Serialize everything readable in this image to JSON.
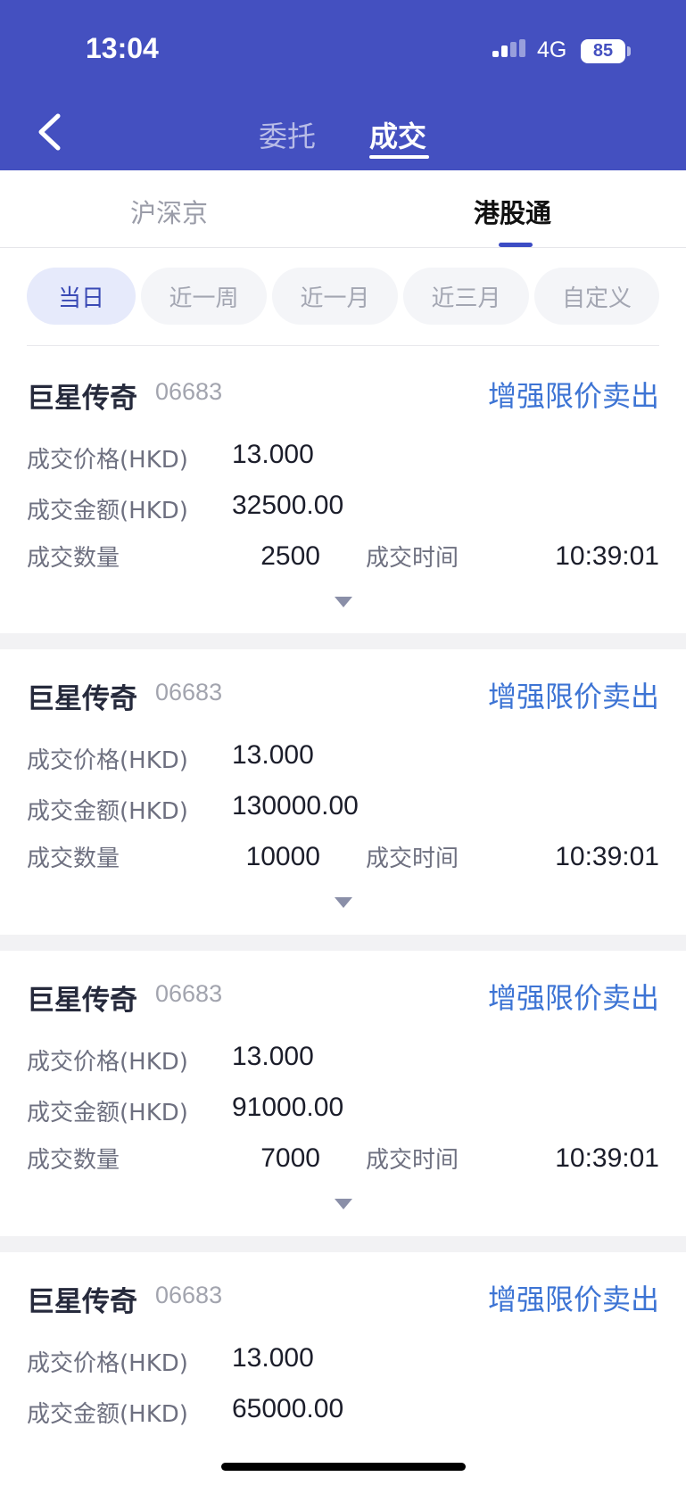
{
  "status_bar": {
    "time": "13:04",
    "network": "4G",
    "battery": "85"
  },
  "header": {
    "tabs": [
      {
        "label": "委托",
        "active": false
      },
      {
        "label": "成交",
        "active": true
      }
    ]
  },
  "markets": [
    {
      "label": "沪深京",
      "active": false
    },
    {
      "label": "港股通",
      "active": true
    }
  ],
  "filters": [
    {
      "label": "当日",
      "active": true
    },
    {
      "label": "近一周",
      "active": false
    },
    {
      "label": "近一月",
      "active": false
    },
    {
      "label": "近三月",
      "active": false
    },
    {
      "label": "自定义",
      "active": false
    }
  ],
  "labels": {
    "price": "成交价格(HKD)",
    "amount": "成交金额(HKD)",
    "quantity": "成交数量",
    "time": "成交时间"
  },
  "trades": [
    {
      "name": "巨星传奇",
      "code": "06683",
      "order_type": "增强限价卖出",
      "price": "13.000",
      "amount": "32500.00",
      "quantity": "2500",
      "time": "10:39:01"
    },
    {
      "name": "巨星传奇",
      "code": "06683",
      "order_type": "增强限价卖出",
      "price": "13.000",
      "amount": "130000.00",
      "quantity": "10000",
      "time": "10:39:01"
    },
    {
      "name": "巨星传奇",
      "code": "06683",
      "order_type": "增强限价卖出",
      "price": "13.000",
      "amount": "91000.00",
      "quantity": "7000",
      "time": "10:39:01"
    },
    {
      "name": "巨星传奇",
      "code": "06683",
      "order_type": "增强限价卖出",
      "price": "13.000",
      "amount": "65000.00"
    }
  ],
  "colors": {
    "header_bg": "#4450c0",
    "accent_blue": "#3d74d4",
    "active_chip_bg": "#e6eafb"
  }
}
